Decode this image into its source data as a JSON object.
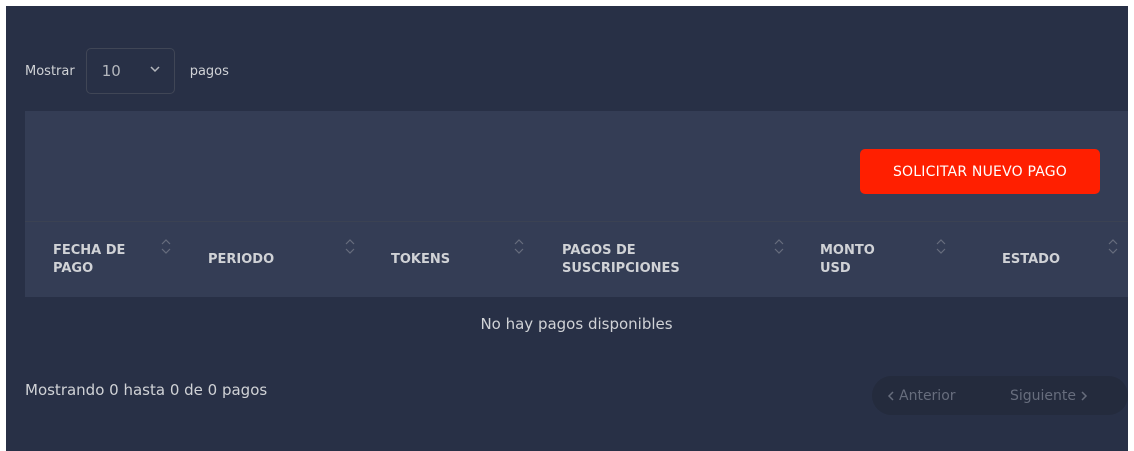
{
  "length": {
    "prefix": "Mostrar",
    "selected": "10",
    "suffix": "pagos"
  },
  "actions": {
    "request_label": "SOLICITAR NUEVO PAGO"
  },
  "table": {
    "headers": [
      "FECHA DE PAGO",
      "PERIODO",
      "TOKENS",
      "PAGOS DE SUSCRIPCIONES",
      "MONTO USD",
      "ESTADO"
    ],
    "empty_message": "No hay pagos disponibles"
  },
  "footer": {
    "info": "Mostrando 0 hasta 0 de 0 pagos",
    "prev_label": "Anterior",
    "next_label": "Siguiente"
  },
  "colors": {
    "background": "#283046",
    "header": "#343d55",
    "accent": "#ff1f00",
    "text": "#d0d2d6"
  }
}
